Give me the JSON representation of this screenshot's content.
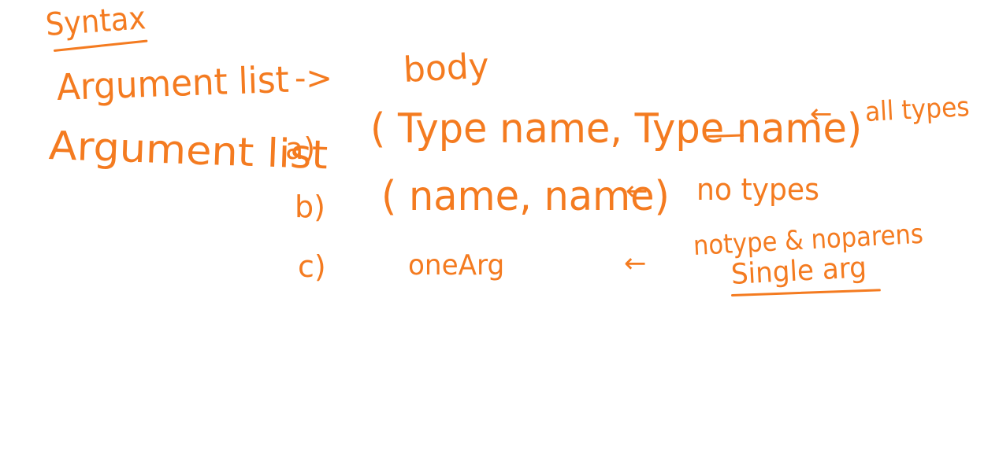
{
  "ink_color": "#f47b20",
  "background": "#ffffff",
  "heading": "Syntax",
  "rule": {
    "lhs": "Argument list",
    "arrow": "->",
    "rhs": "body"
  },
  "arglist_label": "Argument list",
  "forms": [
    {
      "label": "a)",
      "code": "( Type name, Type name)",
      "note_arrow": "←",
      "note": "all types"
    },
    {
      "label": "b)",
      "code": "( name, name)",
      "note_arrow": "←",
      "note": "no types"
    },
    {
      "label": "c)",
      "code": "oneArg",
      "note_arrow": "←",
      "note_line1": "notype & noparens",
      "note_line2": "Single arg"
    }
  ]
}
